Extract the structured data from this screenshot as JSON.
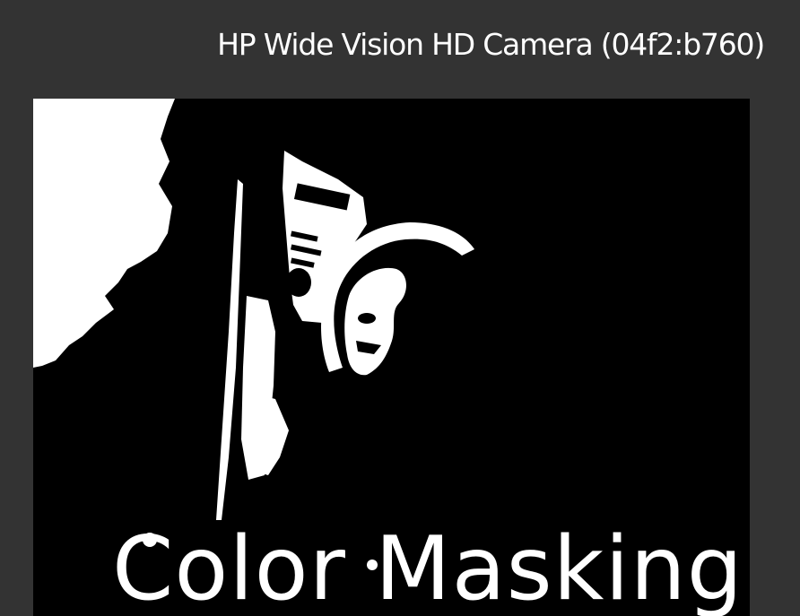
{
  "window": {
    "camera_title": "HP Wide Vision HD Camera (04f2:b760)"
  },
  "video": {
    "overlay_label": "Color Masking",
    "mask_foreground_color": "#ffffff",
    "mask_background_color": "#000000"
  },
  "colors": {
    "window_background": "#333333",
    "title_text": "#ffffff"
  }
}
